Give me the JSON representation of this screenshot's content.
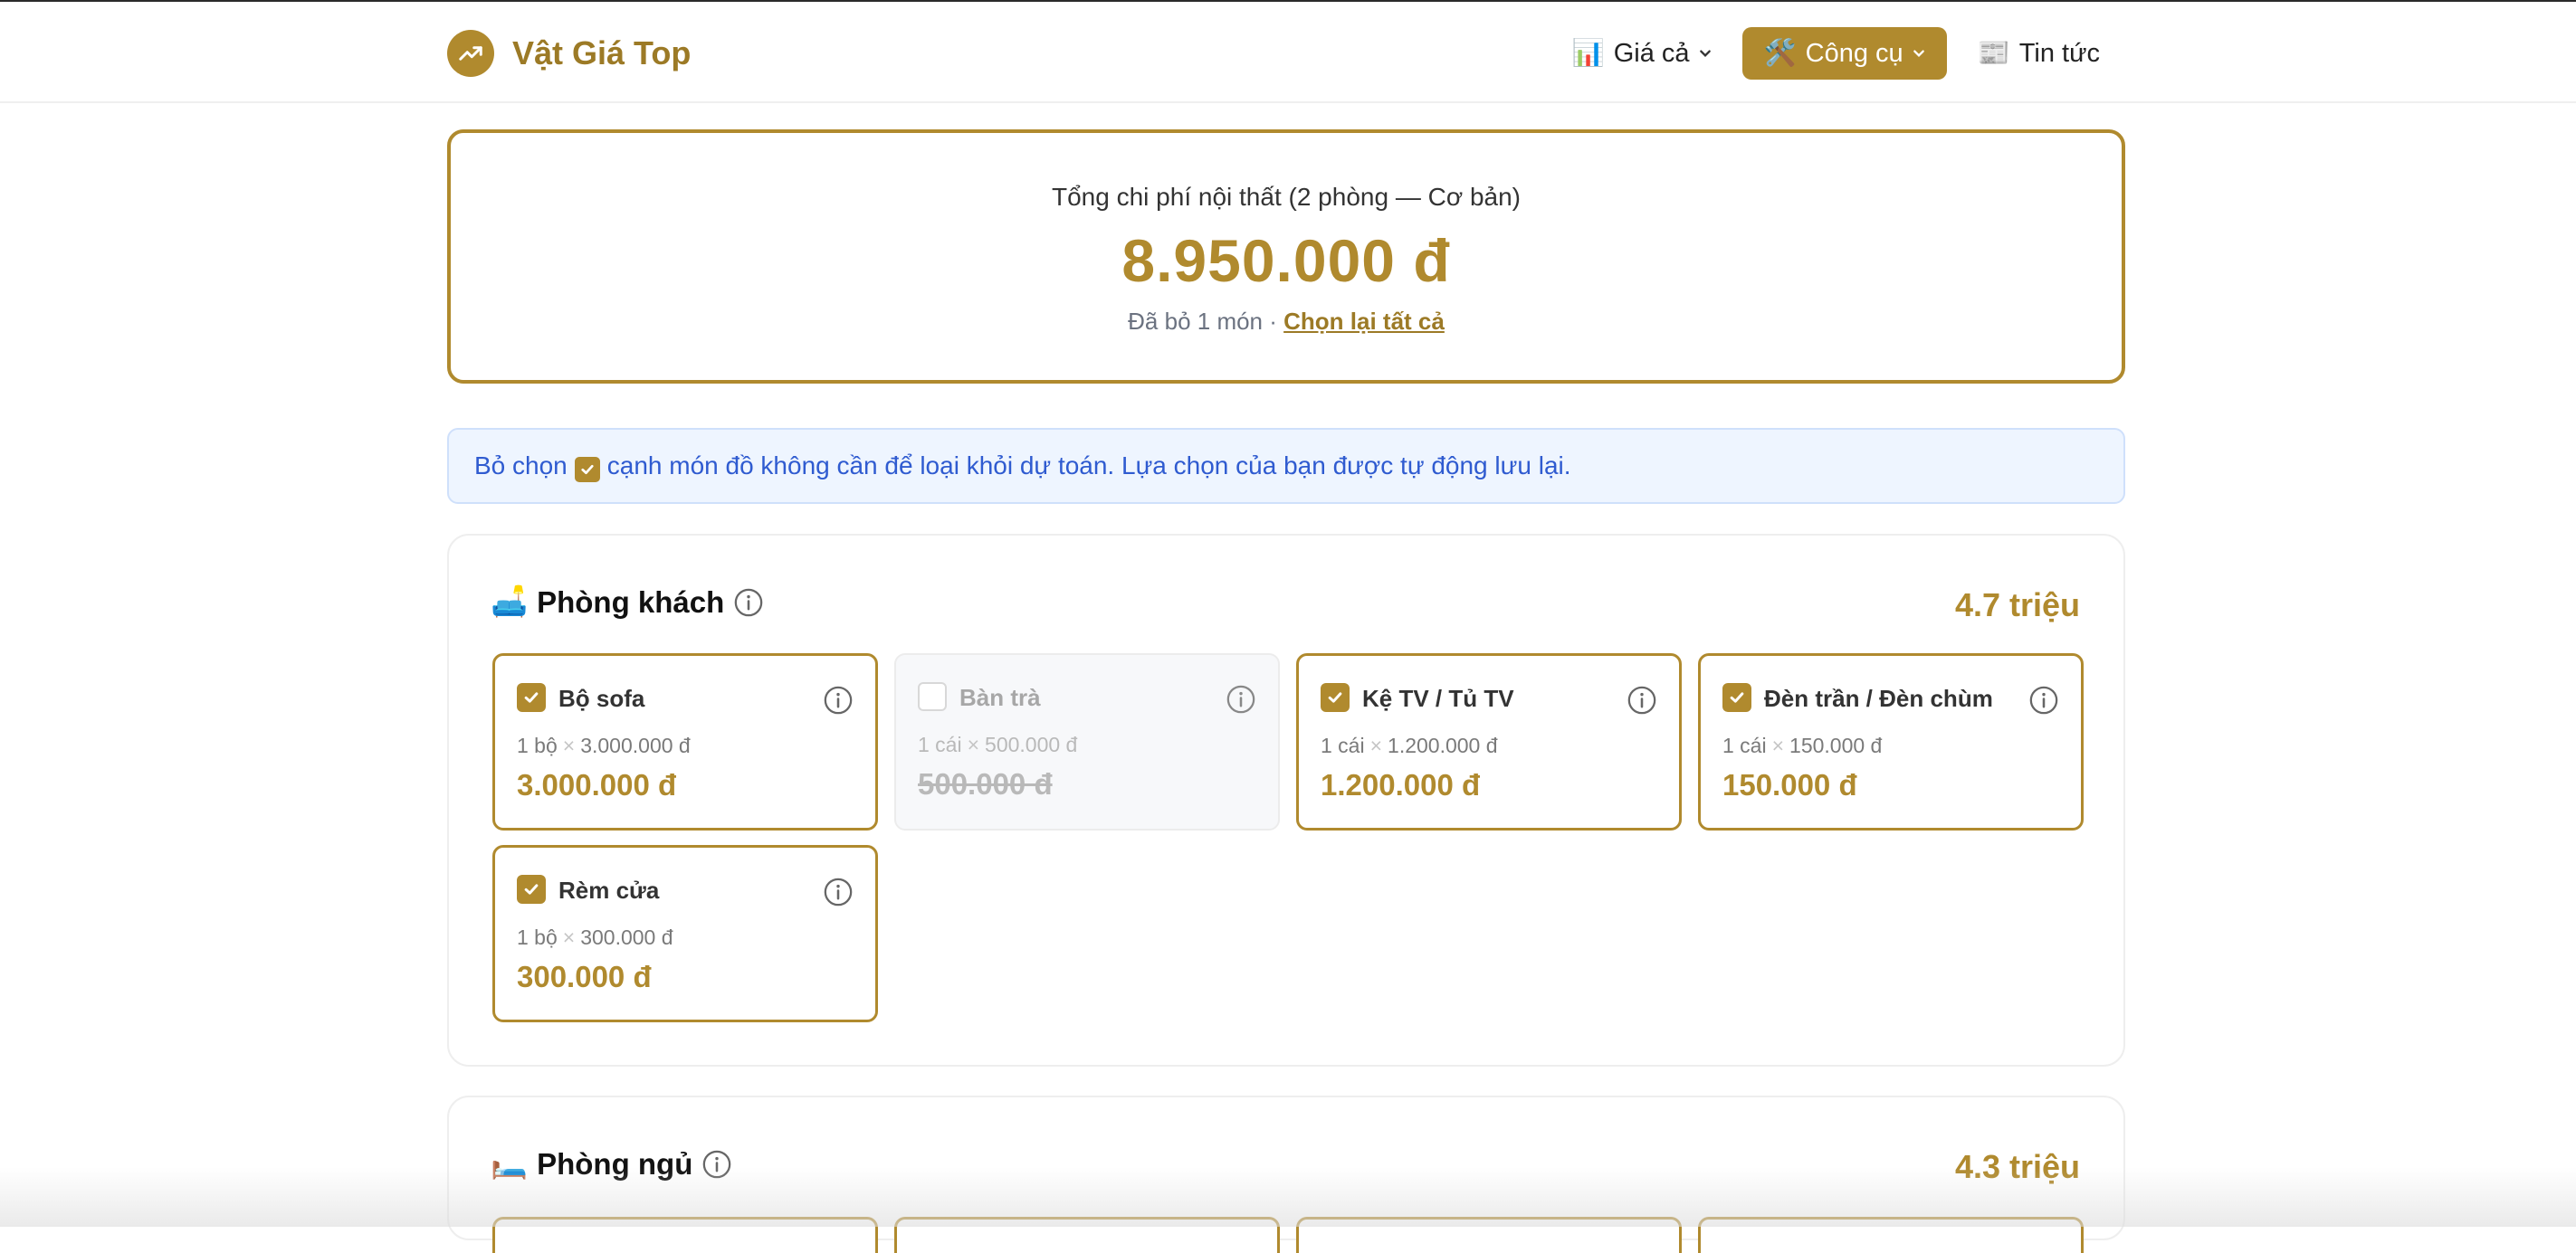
{
  "header": {
    "brand": "Vật Giá Top",
    "nav": [
      {
        "emoji": "📊",
        "label": "Giá cả",
        "dropdown": true,
        "active": false
      },
      {
        "emoji": "🛠️",
        "label": "Công cụ",
        "dropdown": true,
        "active": true
      },
      {
        "emoji": "📰",
        "label": "Tin tức",
        "dropdown": false,
        "active": false
      }
    ]
  },
  "summary": {
    "label": "Tổng chi phí nội thất (2 phòng — Cơ bản)",
    "total": "8.950.000 đ",
    "removed_text": "Đã bỏ 1 món · ",
    "reset_link": "Chọn lại tất cả"
  },
  "notice": {
    "before": "Bỏ chọn",
    "after": "cạnh món đồ không cần để loại khỏi dự toán. Lựa chọn của bạn được tự động lưu lại."
  },
  "rooms": [
    {
      "emoji": "🛋️",
      "name": "Phòng khách",
      "total": "4.7 triệu",
      "items": [
        {
          "name": "Bộ sofa",
          "qty": "1 bộ",
          "unit_price": "3.000.000 đ",
          "price": "3.000.000 đ",
          "checked": true
        },
        {
          "name": "Bàn trà",
          "qty": "1 cái",
          "unit_price": "500.000 đ",
          "price": "500.000 đ",
          "checked": false
        },
        {
          "name": "Kệ TV / Tủ TV",
          "qty": "1 cái",
          "unit_price": "1.200.000 đ",
          "price": "1.200.000 đ",
          "checked": true
        },
        {
          "name": "Đèn trần / Đèn chùm",
          "qty": "1 cái",
          "unit_price": "150.000 đ",
          "price": "150.000 đ",
          "checked": true
        },
        {
          "name": "Rèm cửa",
          "qty": "1 bộ",
          "unit_price": "300.000 đ",
          "price": "300.000 đ",
          "checked": true
        }
      ]
    },
    {
      "emoji": "🛏️",
      "name": "Phòng ngủ",
      "total": "4.3 triệu",
      "items": []
    }
  ],
  "times_symbol": "×",
  "colors": {
    "accent": "#b08a2e",
    "info_text": "#2f5bd0",
    "info_bg": "#eef5ff"
  }
}
